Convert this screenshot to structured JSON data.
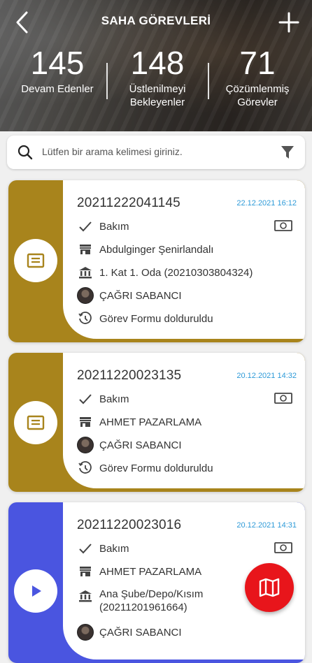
{
  "header": {
    "title": "SAHA GÖREVLERİ",
    "stats": [
      {
        "value": "145",
        "label_line1": "Devam Edenler",
        "label_line2": ""
      },
      {
        "value": "148",
        "label_line1": "Üstlenilmeyi",
        "label_line2": "Bekleyenler"
      },
      {
        "value": "71",
        "label_line1": "Çözümlenmiş",
        "label_line2": "Görevler"
      }
    ]
  },
  "search": {
    "placeholder": "Lütfen bir arama kelimesi giriniz."
  },
  "tasks": [
    {
      "code": "20211222041145",
      "date": "22.12.2021 16:12",
      "type": "Bakım",
      "company": "Abdulginger Şenirlandalı",
      "location": "1. Kat 1. Oda (20210303804324)",
      "assignee": "ÇAĞRI SABANCI",
      "status": "Görev Formu dolduruldu",
      "accent_color": "#a8841c",
      "action_icon": "form-icon"
    },
    {
      "code": "20211220023135",
      "date": "20.12.2021 14:32",
      "type": "Bakım",
      "company": "AHMET PAZARLAMA",
      "assignee": "ÇAĞRI SABANCI",
      "status": "Görev Formu dolduruldu",
      "accent_color": "#a8841c",
      "action_icon": "form-icon"
    },
    {
      "code": "20211220023016",
      "date": "20.12.2021 14:31",
      "type": "Bakım",
      "company": "AHMET PAZARLAMA",
      "location_line1": "Ana Şube/Depo/Kısım",
      "location_line2": "(20211201961664)",
      "assignee": "ÇAĞRI SABANCI",
      "accent_color": "#4a55e0",
      "action_icon": "play-icon"
    }
  ],
  "fab": {
    "icon": "map-icon",
    "color": "#e8151b"
  }
}
